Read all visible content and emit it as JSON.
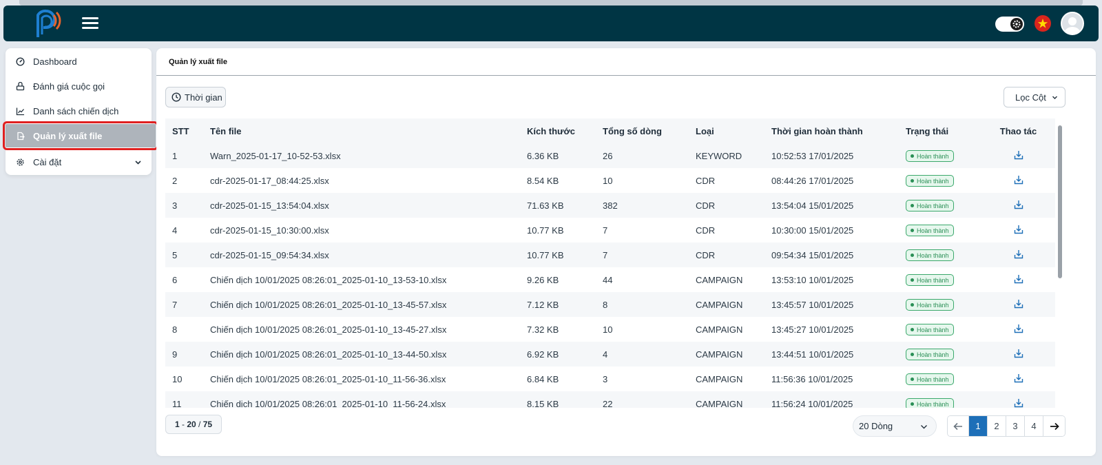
{
  "header": {
    "logo_icon": "p-signal-logo-icon",
    "menu_icon": "hamburger-icon",
    "theme_toggle_icon": "gear-icon",
    "language_flag_icon": "vietnam-flag-icon",
    "avatar_icon": "user-avatar-icon"
  },
  "sidebar": {
    "items": [
      {
        "label": "Dashboard",
        "icon": "dashboard-gauge-icon"
      },
      {
        "label": "Đánh giá cuộc gọi",
        "icon": "call-review-icon"
      },
      {
        "label": "Danh sách chiến dịch",
        "icon": "line-chart-icon"
      },
      {
        "label": "Quản lý xuất file",
        "icon": "file-export-icon",
        "active": true
      },
      {
        "label": "Cài đặt",
        "icon": "settings-gear-icon",
        "expandable": true
      }
    ]
  },
  "main": {
    "title": "Quản lý xuất file",
    "time_filter_label": "Thời gian",
    "column_filter_label": "Lọc Cột",
    "table": {
      "columns": [
        "STT",
        "Tên file",
        "Kích thước",
        "Tổng số dòng",
        "Loại",
        "Thời gian hoàn thành",
        "Trạng thái",
        "Thao tác"
      ],
      "rows": [
        [
          "1",
          "Warn_2025-01-17_10-52-53.xlsx",
          "6.36 KB",
          "26",
          "KEYWORD",
          "10:52:53 17/01/2025",
          "Hoàn thành"
        ],
        [
          "2",
          "cdr-2025-01-17_08:44:25.xlsx",
          "8.54 KB",
          "10",
          "CDR",
          "08:44:26 17/01/2025",
          "Hoàn thành"
        ],
        [
          "3",
          "cdr-2025-01-15_13:54:04.xlsx",
          "71.63 KB",
          "382",
          "CDR",
          "13:54:04 15/01/2025",
          "Hoàn thành"
        ],
        [
          "4",
          "cdr-2025-01-15_10:30:00.xlsx",
          "10.77 KB",
          "7",
          "CDR",
          "10:30:00 15/01/2025",
          "Hoàn thành"
        ],
        [
          "5",
          "cdr-2025-01-15_09:54:34.xlsx",
          "10.77 KB",
          "7",
          "CDR",
          "09:54:34 15/01/2025",
          "Hoàn thành"
        ],
        [
          "6",
          "Chiến dịch 10/01/2025 08:26:01_2025-01-10_13-53-10.xlsx",
          "9.26 KB",
          "44",
          "CAMPAIGN",
          "13:53:10 10/01/2025",
          "Hoàn thành"
        ],
        [
          "7",
          "Chiến dịch 10/01/2025 08:26:01_2025-01-10_13-45-57.xlsx",
          "7.12 KB",
          "8",
          "CAMPAIGN",
          "13:45:57 10/01/2025",
          "Hoàn thành"
        ],
        [
          "8",
          "Chiến dịch 10/01/2025 08:26:01_2025-01-10_13-45-27.xlsx",
          "7.32 KB",
          "10",
          "CAMPAIGN",
          "13:45:27 10/01/2025",
          "Hoàn thành"
        ],
        [
          "9",
          "Chiến dịch 10/01/2025 08:26:01_2025-01-10_13-44-50.xlsx",
          "6.92 KB",
          "4",
          "CAMPAIGN",
          "13:44:51 10/01/2025",
          "Hoàn thành"
        ],
        [
          "10",
          "Chiến dịch 10/01/2025 08:26:01_2025-01-10_11-56-36.xlsx",
          "6.84 KB",
          "3",
          "CAMPAIGN",
          "11:56:36 10/01/2025",
          "Hoàn thành"
        ],
        [
          "11",
          "Chiến dịch 10/01/2025 08:26:01_2025-01-10_11-56-24.xlsx",
          "8.15 KB",
          "22",
          "CAMPAIGN",
          "11:56:24 10/01/2025",
          "Hoàn thành"
        ]
      ],
      "action_icon": "download-icon"
    },
    "range": {
      "start": "1",
      "end": "20",
      "total": "75"
    },
    "rows_per_page": "20 Dòng",
    "pagination": {
      "pages": [
        "1",
        "2",
        "3",
        "4"
      ],
      "current": "1"
    }
  },
  "colors": {
    "topbar": "#003544",
    "accent": "#1d6fb8",
    "status_green": "#2a8f56",
    "active_highlight": "#e02020"
  }
}
